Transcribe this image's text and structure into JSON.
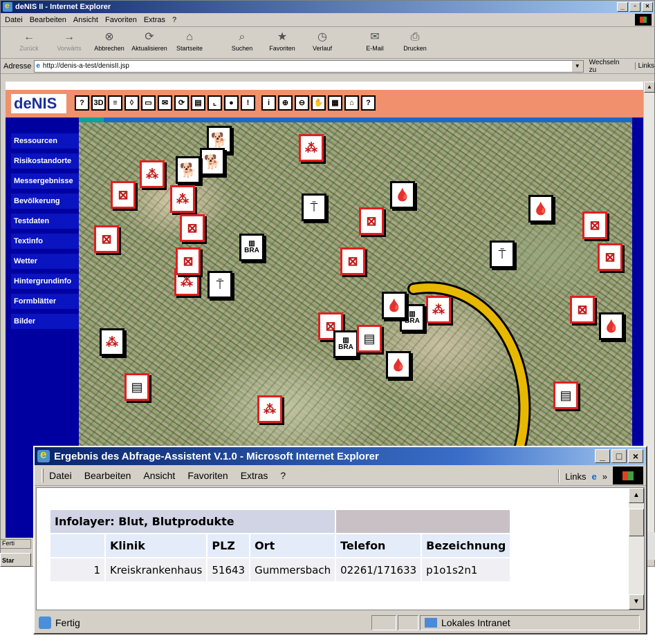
{
  "main_window": {
    "title": "deNIS II - Internet Explorer",
    "menu": [
      "Datei",
      "Bearbeiten",
      "Ansicht",
      "Favoriten",
      "Extras",
      "?"
    ],
    "toolbar": [
      {
        "label": "Zurück",
        "icon": "back-arrow-icon",
        "enabled": false
      },
      {
        "label": "Vorwärts",
        "icon": "forward-arrow-icon",
        "enabled": false
      },
      {
        "label": "Abbrechen",
        "icon": "stop-icon",
        "enabled": true
      },
      {
        "label": "Aktualisieren",
        "icon": "refresh-icon",
        "enabled": true
      },
      {
        "label": "Startseite",
        "icon": "home-icon",
        "enabled": true
      },
      {
        "label": "Suchen",
        "icon": "search-icon",
        "enabled": true
      },
      {
        "label": "Favoriten",
        "icon": "favorites-icon",
        "enabled": true
      },
      {
        "label": "Verlauf",
        "icon": "history-icon",
        "enabled": true
      },
      {
        "label": "E-Mail",
        "icon": "mail-icon",
        "enabled": true
      },
      {
        "label": "Drucken",
        "icon": "print-icon",
        "enabled": true
      }
    ],
    "address_label": "Adresse",
    "address_value": "http://denis-a-test/denisII.jsp",
    "go_label": "Wechseln zu",
    "links_label": "Links"
  },
  "denis": {
    "logo": "deNIS",
    "tool_icons": [
      "?",
      "3D",
      "≡",
      "◊",
      "▭",
      "✉",
      "⟳",
      "▤",
      "⌞",
      "●",
      "!",
      "i",
      "⊕",
      "⊖",
      "✋",
      "▦",
      "⌂",
      "?"
    ],
    "sidebar": [
      "Ressourcen",
      "Risikostandorte",
      "Messergebnisse",
      "Bevölkerung",
      "Testdaten",
      "Textinfo",
      "Wetter",
      "Hintergrundinfo",
      "Formblätter",
      "Bilder"
    ]
  },
  "map_markers": [
    {
      "kind": "dog",
      "red": false
    },
    {
      "kind": "dog",
      "red": false
    },
    {
      "kind": "dog",
      "red": false
    },
    {
      "kind": "spray",
      "red": true
    },
    {
      "kind": "spray",
      "red": true
    },
    {
      "kind": "spray",
      "red": true
    },
    {
      "kind": "cart",
      "red": true
    },
    {
      "kind": "cart",
      "red": true
    },
    {
      "kind": "cart",
      "red": true
    },
    {
      "kind": "BRA",
      "red": false
    },
    {
      "kind": "BRA",
      "red": false
    },
    {
      "kind": "BRA",
      "red": false
    },
    {
      "kind": "blood",
      "red": false
    },
    {
      "kind": "blood",
      "red": false
    },
    {
      "kind": "blood",
      "red": false
    }
  ],
  "taskbar_fragments": {
    "status": "Ferti",
    "start": "Star"
  },
  "popup": {
    "title": "Ergebnis des Abfrage-Assistent V.1.0 - Microsoft Internet Explorer",
    "menu": [
      "Datei",
      "Bearbeiten",
      "Ansicht",
      "Favoriten",
      "Extras",
      "?"
    ],
    "links_label": "Links",
    "table": {
      "caption": "Infolayer: Blut, Blutprodukte",
      "headers": [
        "Klinik",
        "PLZ",
        "Ort",
        "Telefon",
        "Bezeichnung"
      ],
      "rows": [
        {
          "n": "1",
          "Klinik": "Kreiskrankenhaus",
          "PLZ": "51643",
          "Ort": "Gummersbach",
          "Telefon": "02261/171633",
          "Bezeichnung": "p1o1s2n1"
        }
      ]
    },
    "status_text": "Fertig",
    "zone_text": "Lokales Intranet"
  },
  "colors": {
    "denis_header": "#f0906c",
    "sidebar": "#0a14c0",
    "frame": "#0000a0",
    "arrow": "#e8b800"
  }
}
